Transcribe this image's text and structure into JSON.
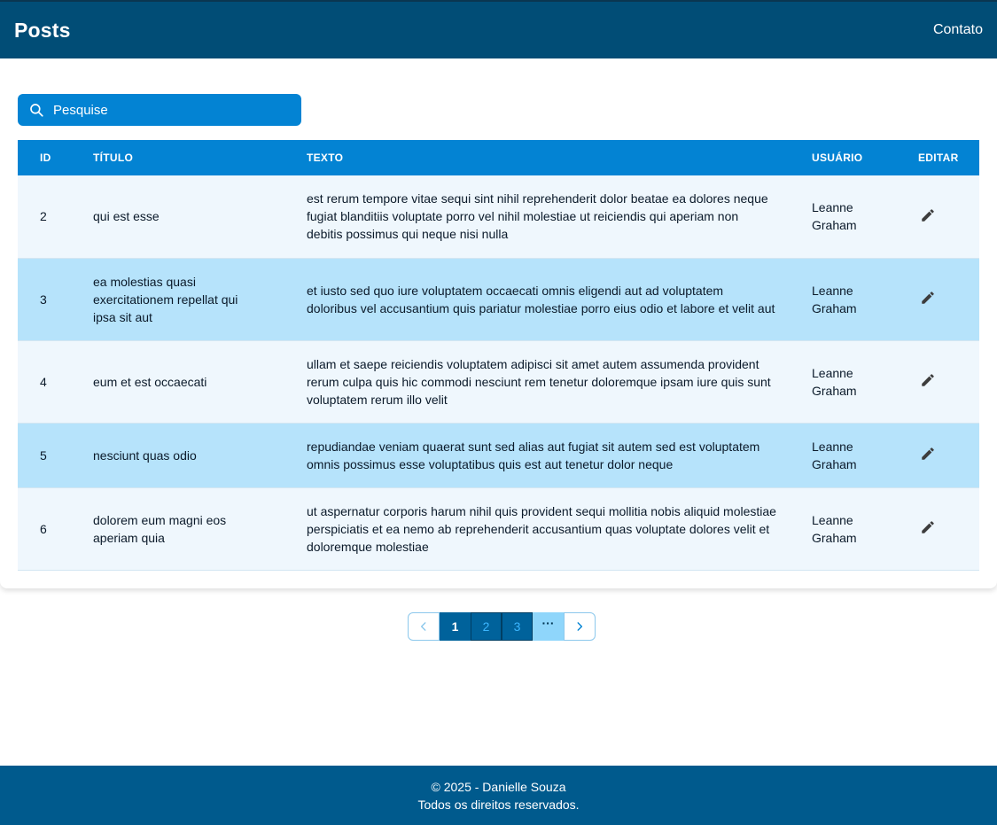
{
  "header": {
    "title": "Posts",
    "nav_link": "Contato"
  },
  "search": {
    "placeholder": "Pesquise",
    "icon": "search-icon"
  },
  "table": {
    "columns": [
      "ID",
      "TÍTULO",
      "TEXTO",
      "USUÁRIO",
      "EDITAR"
    ],
    "rows": [
      {
        "id": "2",
        "title": "qui est esse",
        "text": "est rerum tempore vitae sequi sint nihil reprehenderit dolor beatae ea dolores neque fugiat blanditiis voluptate porro vel nihil molestiae ut reiciendis qui aperiam non debitis possimus qui neque nisi nulla",
        "user": "Leanne Graham"
      },
      {
        "id": "3",
        "title": "ea molestias quasi exercitationem repellat qui ipsa sit aut",
        "text": "et iusto sed quo iure voluptatem occaecati omnis eligendi aut ad voluptatem doloribus vel accusantium quis pariatur molestiae porro eius odio et labore et velit aut",
        "user": "Leanne Graham"
      },
      {
        "id": "4",
        "title": "eum et est occaecati",
        "text": "ullam et saepe reiciendis voluptatem adipisci sit amet autem assumenda provident rerum culpa quis hic commodi nesciunt rem tenetur doloremque ipsam iure quis sunt voluptatem rerum illo velit",
        "user": "Leanne Graham"
      },
      {
        "id": "5",
        "title": "nesciunt quas odio",
        "text": "repudiandae veniam quaerat sunt sed alias aut fugiat sit autem sed est voluptatem omnis possimus esse voluptatibus quis est aut tenetur dolor neque",
        "user": "Leanne Graham"
      },
      {
        "id": "6",
        "title": "dolorem eum magni eos aperiam quia",
        "text": "ut aspernatur corporis harum nihil quis provident sequi mollitia nobis aliquid molestiae perspiciatis et ea nemo ab reprehenderit accusantium quas voluptate dolores velit et doloremque molestiae",
        "user": "Leanne Graham"
      }
    ],
    "edit_icon": "pencil-icon"
  },
  "pagination": {
    "pages": [
      "1",
      "2",
      "3"
    ],
    "active_page": "1",
    "ellipsis": "···",
    "prev_icon": "chevron-left-icon",
    "next_icon": "chevron-right-icon"
  },
  "footer": {
    "line1": "© 2025 - Danielle Souza",
    "line2": "Todos os direitos reservados."
  },
  "colors": {
    "header_bg": "#014d76",
    "accent": "#0383d3",
    "row_alt": "#b6e3fb",
    "row_base": "#eff7fd",
    "footer_bg": "#005a8d"
  }
}
